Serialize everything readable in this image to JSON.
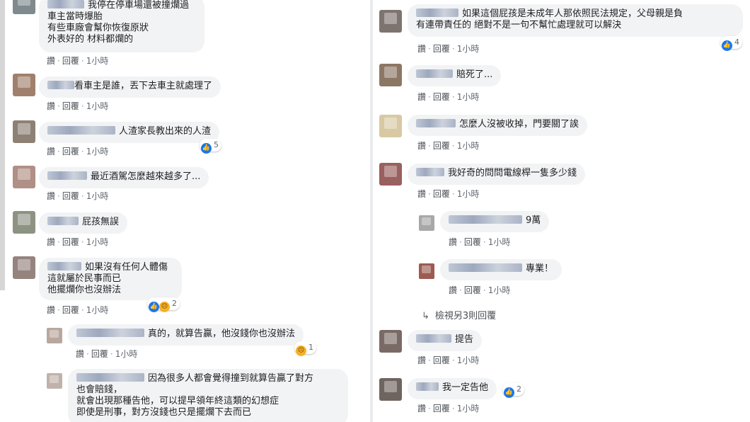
{
  "actions": {
    "like": "讚",
    "reply": "回覆",
    "time": "1小時",
    "sep": "·"
  },
  "left_comments": [
    {
      "lines": [
        "我停在停車場還被撞爛過",
        "車主當時爆胎",
        "有些車廠會幫你恢復原狀",
        "外表好的 材料都爛的"
      ]
    },
    {
      "lines": [
        "看車主是誰，丟下去車主就處理了"
      ]
    },
    {
      "lines": [
        "人渣家長教出來的人渣"
      ],
      "reaction_count": "5"
    },
    {
      "lines": [
        "最近酒駕怎麼越來越多了..."
      ]
    },
    {
      "lines": [
        "屁孩無誤"
      ]
    },
    {
      "lines": [
        "如果沒有任何人體傷",
        "這就屬於民事而已",
        "他擺爛你也沒辦法"
      ],
      "reaction_count": "2"
    },
    {
      "lines": [
        "真的，就算告贏，他沒錢你也沒辦法"
      ],
      "reaction_count": "1"
    },
    {
      "lines": [
        "因為很多人都會覺得撞到就算告贏了對方",
        "也會賠錢，",
        "就會出現那種告他，可以提早領年終這類的幻想症",
        "即使是刑事，對方沒錢也只是擺爛下去而已"
      ]
    }
  ],
  "right_comments": [
    {
      "lines": [
        "如果這個屁孩是未成年人那依照民法規定，父母親是負",
        "有連帶責任的 絕對不是一句不幫忙處理就可以解決"
      ],
      "reaction_count": "4"
    },
    {
      "lines": [
        "賠死了..."
      ]
    },
    {
      "lines": [
        "怎麼人沒被收掉，門要關了誒"
      ]
    },
    {
      "lines": [
        "我好奇的問問電線桿一隻多少錢"
      ]
    },
    {
      "lines": [
        "9萬"
      ]
    },
    {
      "lines": [
        "專業！"
      ]
    },
    {
      "lines": [
        "提告"
      ]
    },
    {
      "lines": [
        "我一定告他"
      ],
      "reaction_count": "2"
    }
  ],
  "more_replies": {
    "arrow": "↳",
    "label": "檢視另3則回覆"
  },
  "icons": {
    "like": "👍",
    "sad": "☹"
  }
}
